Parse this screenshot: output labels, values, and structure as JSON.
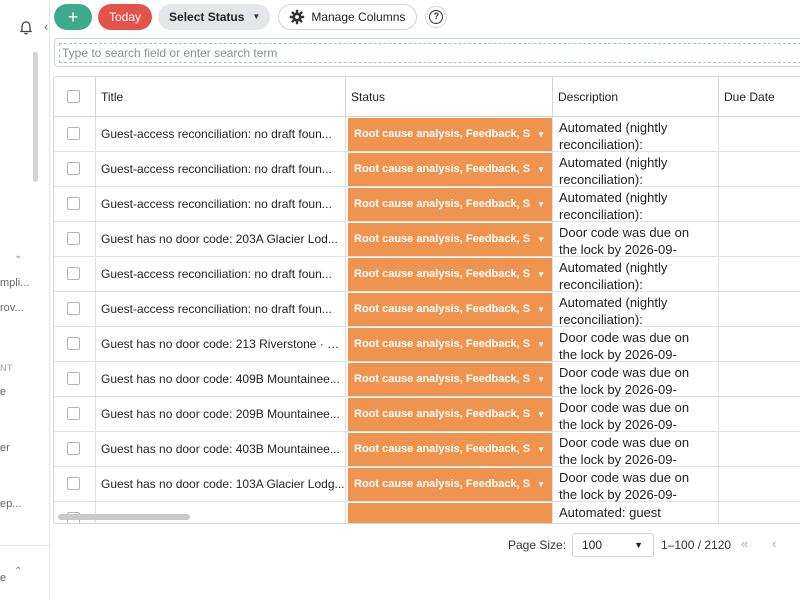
{
  "sidebar": {
    "texts": [
      "mpli...",
      "rov...",
      "NT",
      "e",
      "er",
      "ep...",
      "e"
    ]
  },
  "toolbar": {
    "add_label": "+",
    "today_label": "Today",
    "status_label": "Select Status",
    "columns_label": "Manage Columns",
    "help_label": "?"
  },
  "search": {
    "placeholder": "Type to search field or enter search term",
    "value": ""
  },
  "grid": {
    "columns": [
      "Title",
      "Status",
      "Description",
      "Due Date"
    ],
    "rows": [
      {
        "title": "Guest-access reconciliation: no draft foun...",
        "status": "Root cause analysis, Feedback, S",
        "desc1": "Automated (nightly",
        "desc2": "reconciliation):"
      },
      {
        "title": "Guest-access reconciliation: no draft foun...",
        "status": "Root cause analysis, Feedback, S",
        "desc1": "Automated (nightly",
        "desc2": "reconciliation):"
      },
      {
        "title": "Guest-access reconciliation: no draft foun...",
        "status": "Root cause analysis, Feedback, S",
        "desc1": "Automated (nightly",
        "desc2": "reconciliation):"
      },
      {
        "title": "Guest has no door code: 203A Glacier Lod...",
        "status": "Root cause analysis, Feedback, S",
        "desc1": "Door code was due on",
        "desc2": "the lock by 2026-09-"
      },
      {
        "title": "Guest-access reconciliation: no draft foun...",
        "status": "Root cause analysis, Feedback, S",
        "desc1": "Automated (nightly",
        "desc2": "reconciliation):"
      },
      {
        "title": "Guest-access reconciliation: no draft foun...",
        "status": "Root cause analysis, Feedback, S",
        "desc1": "Automated (nightly",
        "desc2": "reconciliation):"
      },
      {
        "title": "Guest has no door code: 213 Riverstone · C...",
        "status": "Root cause analysis, Feedback, S",
        "desc1": "Door code was due on",
        "desc2": "the lock by 2026-09-"
      },
      {
        "title": "Guest has no door code: 409B Mountainee...",
        "status": "Root cause analysis, Feedback, S",
        "desc1": "Door code was due on",
        "desc2": "the lock by 2026-09-"
      },
      {
        "title": "Guest has no door code: 209B Mountainee...",
        "status": "Root cause analysis, Feedback, S",
        "desc1": "Door code was due on",
        "desc2": "the lock by 2026-09-"
      },
      {
        "title": "Guest has no door code: 403B Mountainee...",
        "status": "Root cause analysis, Feedback, S",
        "desc1": "Door code was due on",
        "desc2": "the lock by 2026-09-"
      },
      {
        "title": "Guest has no door code: 103A Glacier Lodg...",
        "status": "Root cause analysis, Feedback, S",
        "desc1": "Door code was due on",
        "desc2": "the lock by 2026-09-"
      },
      {
        "title": "",
        "status": "",
        "desc1": "Automated: guest",
        "desc2": ""
      }
    ]
  },
  "pager": {
    "page_size_label": "Page Size:",
    "page_size_value": "100",
    "range": "1–100 / 2120",
    "first_symbol": "«",
    "prev_symbol": "‹"
  },
  "colors": {
    "add": "#3daa8b",
    "today": "#e3534a",
    "status_pill": "#ef944f"
  },
  "icons": [
    "bell-icon",
    "plus-icon",
    "gear-icon",
    "help-icon",
    "chevron-down-icon",
    "first-page-icon",
    "prev-page-icon"
  ]
}
